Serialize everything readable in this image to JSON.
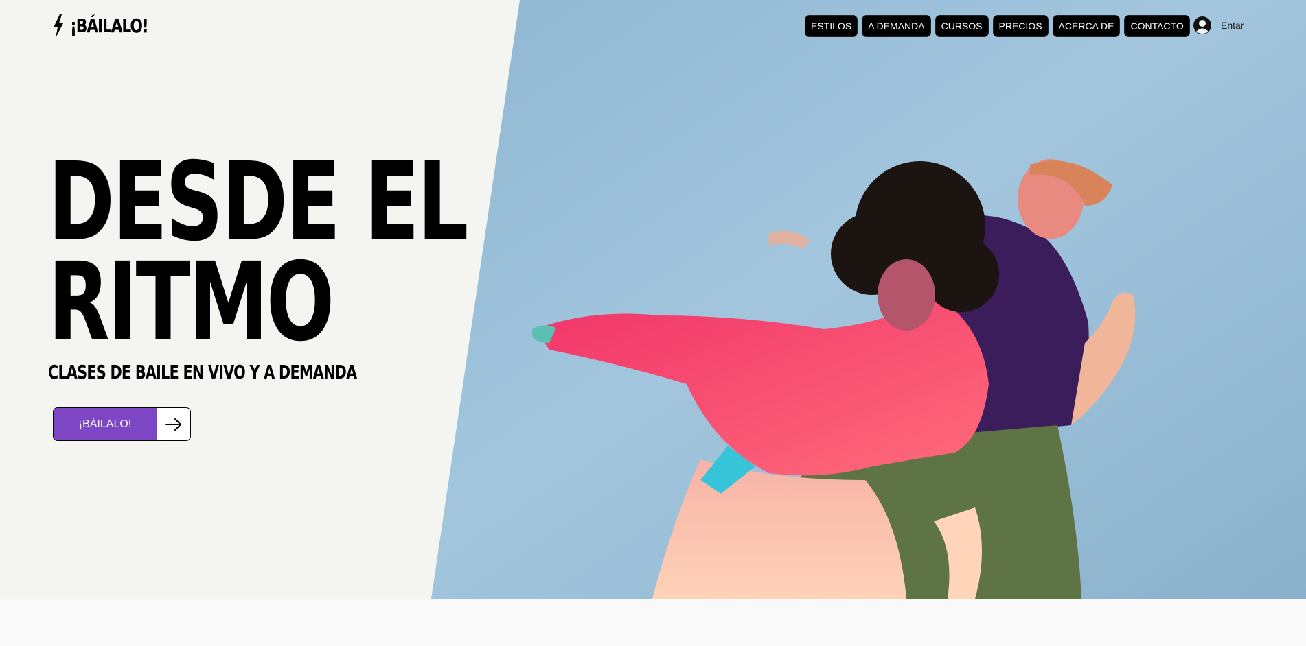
{
  "brand": {
    "name": "¡BÁILALO!",
    "logo_icon": "lightning-bolt-icon"
  },
  "nav": {
    "items": [
      {
        "label": "ESTILOS"
      },
      {
        "label": "A DEMANDA"
      },
      {
        "label": "CURSOS"
      },
      {
        "label": "PRECIOS"
      },
      {
        "label": "ACERCA DE"
      },
      {
        "label": "CONTACTO"
      }
    ]
  },
  "login": {
    "label": "Entar",
    "icon": "user-avatar-icon"
  },
  "hero": {
    "headline_line1": "DESDE EL",
    "headline_line2": "RITMO",
    "subheadline": "CLASES DE BAILE EN VIVO Y A DEMANDA",
    "cta_label": "¡BÁILALO!",
    "cta_icon": "arrow-right-icon",
    "image_icon": "dancers-photo"
  },
  "colors": {
    "cta_purple": "#7d46c4",
    "hero_left_bg": "#f4f4f1",
    "hero_photo_sky": "#9cc0d8",
    "nav_bg": "#000000"
  }
}
